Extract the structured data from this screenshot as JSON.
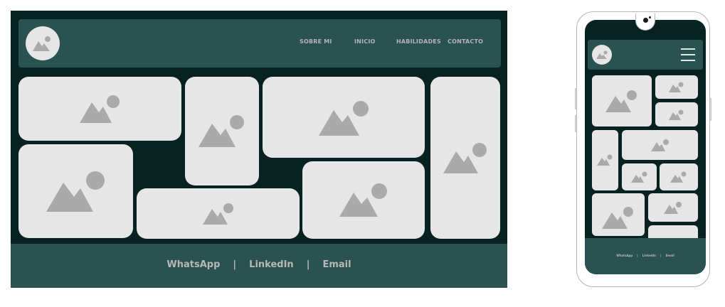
{
  "nav": {
    "links": [
      {
        "label": "SOBRE MI"
      },
      {
        "label": "INICIO"
      },
      {
        "label": "HABILIDADES"
      },
      {
        "label": "CONTACTO"
      }
    ]
  },
  "footer": {
    "links": [
      {
        "label": "WhatsApp"
      },
      {
        "label": "LinkedIn"
      },
      {
        "label": "Email"
      }
    ],
    "separator": "|"
  },
  "icons": {
    "logo": "image-placeholder-icon",
    "tile": "image-placeholder-icon",
    "menu": "hamburger-menu-icon"
  },
  "colors": {
    "background": "#072220",
    "panel": "#2a5250",
    "placeholder": "#e6e6e6",
    "placeholder_icon": "#aaaaaa",
    "text": "#b8b8b8"
  }
}
